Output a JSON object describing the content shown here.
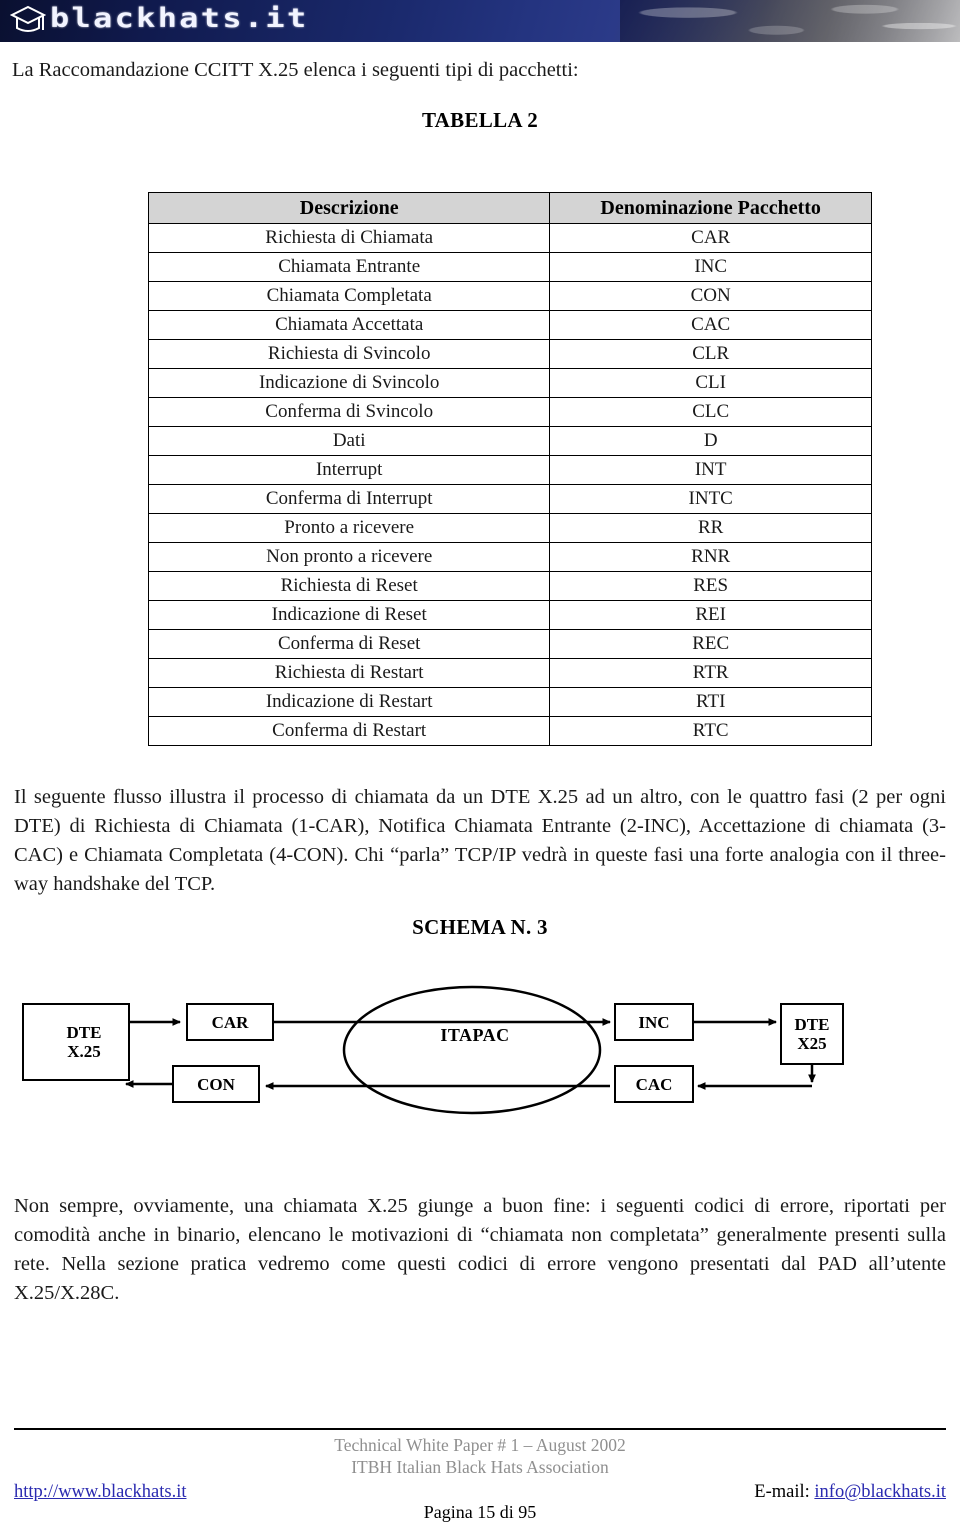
{
  "banner": {
    "wordmark": "blackhats.it",
    "logo_icon": "graduation-cap-icon"
  },
  "intro_line": "La Raccomandazione CCITT X.25 elenca i seguenti tipi di pacchetti:",
  "table": {
    "title": "TABELLA 2",
    "headers": [
      "Descrizione",
      "Denominazione Pacchetto"
    ],
    "rows": [
      [
        "Richiesta di Chiamata",
        "CAR"
      ],
      [
        "Chiamata Entrante",
        "INC"
      ],
      [
        "Chiamata Completata",
        "CON"
      ],
      [
        "Chiamata Accettata",
        "CAC"
      ],
      [
        "Richiesta di Svincolo",
        "CLR"
      ],
      [
        "Indicazione di Svincolo",
        "CLI"
      ],
      [
        "Conferma di Svincolo",
        "CLC"
      ],
      [
        "Dati",
        "D"
      ],
      [
        "Interrupt",
        "INT"
      ],
      [
        "Conferma di Interrupt",
        "INTC"
      ],
      [
        "Pronto a ricevere",
        "RR"
      ],
      [
        "Non pronto a ricevere",
        "RNR"
      ],
      [
        "Richiesta di Reset",
        "RES"
      ],
      [
        "Indicazione di Reset",
        "REI"
      ],
      [
        "Conferma di Reset",
        "REC"
      ],
      [
        "Richiesta di Restart",
        "RTR"
      ],
      [
        "Indicazione di Restart",
        "RTI"
      ],
      [
        "Conferma di Restart",
        "RTC"
      ]
    ]
  },
  "flow_paragraph": "Il seguente flusso illustra il processo di chiamata da un DTE X.25 ad un altro, con le quattro fasi (2 per ogni DTE) di Richiesta di Chiamata (1-CAR), Notifica Chiamata Entrante (2-INC), Accettazione di chiamata (3-CAC) e Chiamata Completata (4-CON). Chi “parla” TCP/IP vedrà in queste fasi una forte analogia con il three-way handshake del TCP.",
  "schema": {
    "title": "SCHEMA N. 3",
    "nodes": {
      "dte_left": "DTE\nX.25",
      "car": "CAR",
      "con": "CON",
      "itapac": "ITAPAC",
      "inc": "INC",
      "cac": "CAC",
      "dte_right": "DTE\nX25"
    }
  },
  "error_paragraph": "Non sempre, ovviamente, una chiamata X.25 giunge a buon fine: i seguenti codici di errore, riportati per comodità anche in binario, elencano le motivazioni di “chiamata non completata” generalmente presenti sulla rete. Nella sezione pratica vedremo come questi codici di errore vengono presentati dal PAD all’utente X.25/X.28C.",
  "footer": {
    "line1": "Technical White Paper # 1 – August 2002",
    "line2": "ITBH Italian Black Hats Association",
    "url": "http://www.blackhats.it",
    "email_label": "E-mail: ",
    "email": "info@blackhats.it",
    "page": "Pagina 15 di 95"
  },
  "colors": {
    "link": "#2a2ab0",
    "footer_gray": "#8f8f8f",
    "table_header_bg": "#d4d4d4",
    "banner_blue": "#16235f"
  }
}
